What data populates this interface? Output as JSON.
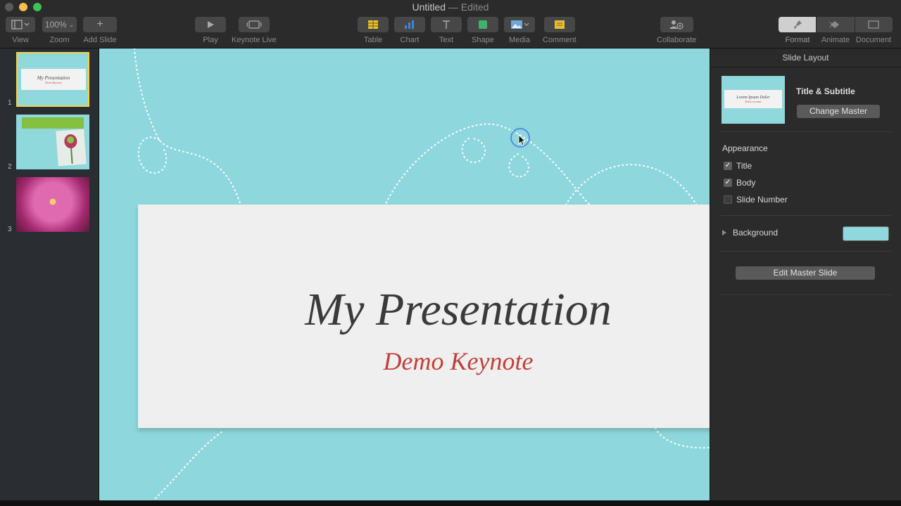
{
  "window": {
    "title": "Untitled",
    "status": "— Edited"
  },
  "toolbar": {
    "view": "View",
    "zoom_value": "100%",
    "zoom": "Zoom",
    "add_slide": "Add Slide",
    "play": "Play",
    "keynote_live": "Keynote Live",
    "table": "Table",
    "chart": "Chart",
    "text": "Text",
    "shape": "Shape",
    "media": "Media",
    "comment": "Comment",
    "collaborate": "Collaborate",
    "format": "Format",
    "animate": "Animate",
    "document": "Document"
  },
  "navigator": {
    "slides": [
      {
        "number": "1",
        "title": "My Presentation",
        "subtitle": "Demo Keynote"
      },
      {
        "number": "2"
      },
      {
        "number": "3"
      }
    ]
  },
  "slide": {
    "title": "My Presentation",
    "subtitle": "Demo Keynote",
    "background_color": "#8ed7dc"
  },
  "inspector": {
    "header": "Slide Layout",
    "master_name": "Title & Subtitle",
    "master_thumb_title": "Lorem Ipsum Dolor",
    "master_thumb_subtitle": "Dolor sit amet",
    "change_master": "Change Master",
    "appearance": "Appearance",
    "options": [
      {
        "label": "Title",
        "checked": true
      },
      {
        "label": "Body",
        "checked": true
      },
      {
        "label": "Slide Number",
        "checked": false
      }
    ],
    "background": "Background",
    "background_swatch": "#8fd8de",
    "edit_master": "Edit Master Slide"
  }
}
